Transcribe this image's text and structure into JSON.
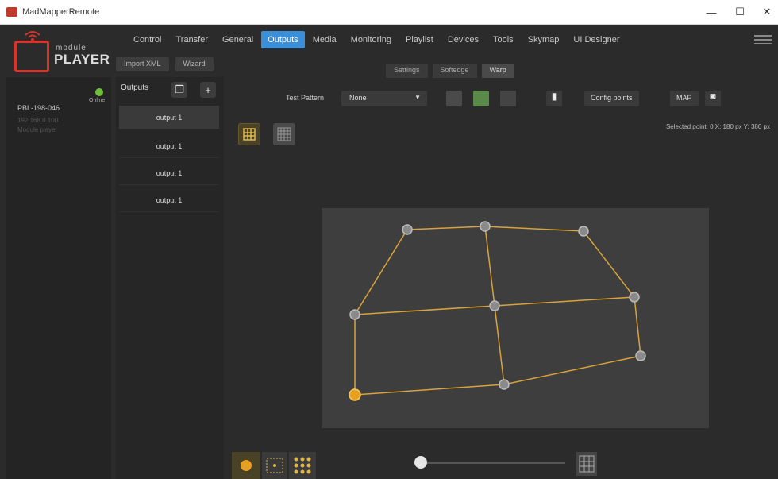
{
  "window": {
    "title": "MadMapperRemote"
  },
  "brand": {
    "small": "module",
    "name": "PLAYER"
  },
  "menu": [
    "Control",
    "Transfer",
    "General",
    "Outputs",
    "Media",
    "Monitoring",
    "Playlist",
    "Devices",
    "Tools",
    "Skymap",
    "UI Designer"
  ],
  "menu_active_index": 3,
  "sub_buttons": [
    "Import XML",
    "Wizard"
  ],
  "sub_tabs": [
    "Settings",
    "Softedge",
    "Warp"
  ],
  "sub_tab_active_index": 2,
  "left_panel": {
    "device_name": "PBL-198-046",
    "status_label": "Online",
    "faint_lines": [
      "192.168.0.100",
      "Module player"
    ]
  },
  "outputs_panel": {
    "title": "Outputs",
    "items": [
      "output 1",
      "output 1",
      "output 1",
      "output 1"
    ]
  },
  "toolbar": {
    "test_pattern_label": "Test Pattern",
    "test_pattern_value": "None",
    "config_button": "Config points",
    "map_button": "MAP"
  },
  "coords": "Selected point: 0   X: 180 px   Y: 380 px",
  "colors": {
    "accent": "#3a8fd8",
    "warp": "#d9a33a",
    "logo_red": "#d9332a",
    "online": "#6dbf3a"
  }
}
